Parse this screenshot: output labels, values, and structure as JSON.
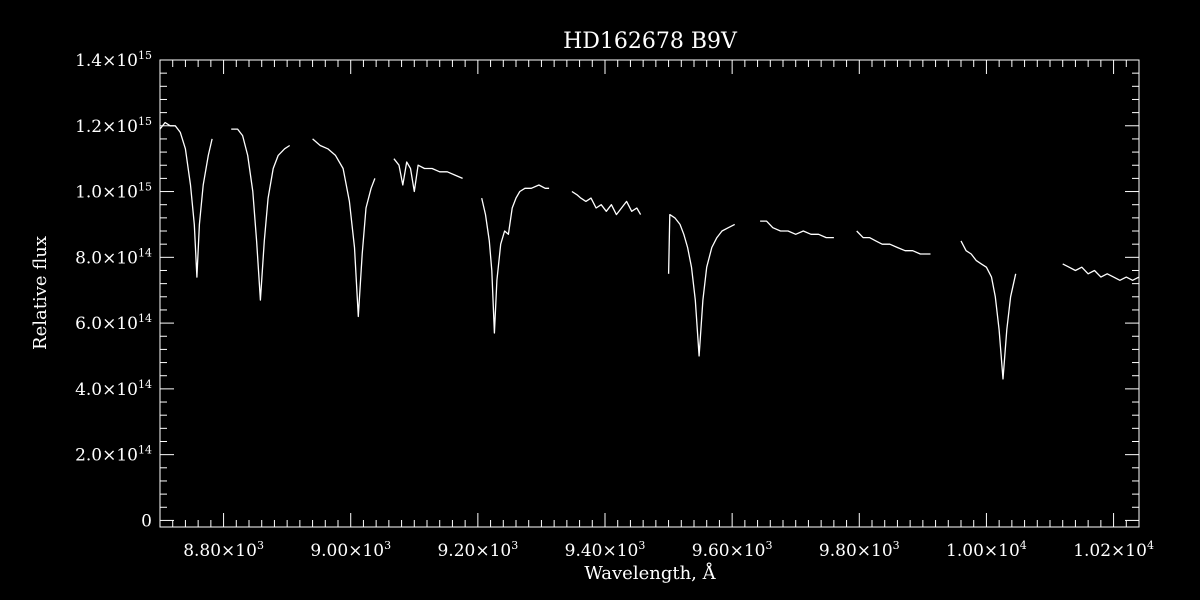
{
  "chart_data": {
    "type": "line",
    "title": "HD162678   B9V",
    "xlabel": "Wavelength, Å",
    "ylabel": "Relative flux",
    "xlim": [
      8700,
      10240
    ],
    "ylim": [
      -0.02,
      1.4
    ],
    "y_unit_exponent": 15,
    "grid": false,
    "line_color": "#ffffff",
    "background": "#000000",
    "x_ticks": [
      {
        "value": 8800,
        "mantissa": "8.80",
        "exp": "3"
      },
      {
        "value": 9000,
        "mantissa": "9.00",
        "exp": "3"
      },
      {
        "value": 9200,
        "mantissa": "9.20",
        "exp": "3"
      },
      {
        "value": 9400,
        "mantissa": "9.40",
        "exp": "3"
      },
      {
        "value": 9600,
        "mantissa": "9.60",
        "exp": "3"
      },
      {
        "value": 9800,
        "mantissa": "9.80",
        "exp": "3"
      },
      {
        "value": 10000,
        "mantissa": "1.00",
        "exp": "4"
      },
      {
        "value": 10200,
        "mantissa": "1.02",
        "exp": "4"
      }
    ],
    "y_ticks": [
      {
        "value": 0.0,
        "mantissa": "0",
        "exp": ""
      },
      {
        "value": 0.2,
        "mantissa": "2.0",
        "exp": "14"
      },
      {
        "value": 0.4,
        "mantissa": "4.0",
        "exp": "14"
      },
      {
        "value": 0.6,
        "mantissa": "6.0",
        "exp": "14"
      },
      {
        "value": 0.8,
        "mantissa": "8.0",
        "exp": "14"
      },
      {
        "value": 1.0,
        "mantissa": "1.0",
        "exp": "15"
      },
      {
        "value": 1.2,
        "mantissa": "1.2",
        "exp": "15"
      },
      {
        "value": 1.4,
        "mantissa": "1.4",
        "exp": "15"
      }
    ],
    "series": [
      {
        "values": [
          [
            8700,
            1.19
          ],
          [
            8708,
            1.21
          ],
          [
            8716,
            1.2
          ],
          [
            8724,
            1.2
          ],
          [
            8732,
            1.18
          ],
          [
            8740,
            1.13
          ],
          [
            8748,
            1.02
          ],
          [
            8754,
            0.9
          ],
          [
            8758,
            0.74
          ],
          [
            8762,
            0.9
          ],
          [
            8768,
            1.02
          ],
          [
            8776,
            1.11
          ],
          [
            8782,
            1.16
          ]
        ]
      },
      {
        "values": [
          [
            8812,
            1.19
          ],
          [
            8822,
            1.19
          ],
          [
            8830,
            1.17
          ],
          [
            8838,
            1.11
          ],
          [
            8846,
            1.0
          ],
          [
            8852,
            0.85
          ],
          [
            8858,
            0.67
          ],
          [
            8864,
            0.85
          ],
          [
            8870,
            0.98
          ],
          [
            8878,
            1.07
          ],
          [
            8886,
            1.11
          ],
          [
            8896,
            1.13
          ],
          [
            8904,
            1.14
          ]
        ]
      },
      {
        "values": [
          [
            8940,
            1.16
          ],
          [
            8952,
            1.14
          ],
          [
            8964,
            1.13
          ],
          [
            8976,
            1.11
          ],
          [
            8988,
            1.07
          ],
          [
            8998,
            0.97
          ],
          [
            9006,
            0.83
          ],
          [
            9012,
            0.62
          ],
          [
            9018,
            0.81
          ],
          [
            9024,
            0.95
          ],
          [
            9032,
            1.01
          ],
          [
            9038,
            1.04
          ]
        ]
      },
      {
        "values": [
          [
            9068,
            1.1
          ],
          [
            9076,
            1.08
          ],
          [
            9082,
            1.02
          ],
          [
            9088,
            1.09
          ],
          [
            9094,
            1.07
          ],
          [
            9100,
            1.0
          ],
          [
            9106,
            1.08
          ],
          [
            9116,
            1.07
          ],
          [
            9128,
            1.07
          ],
          [
            9140,
            1.06
          ],
          [
            9152,
            1.06
          ],
          [
            9164,
            1.05
          ],
          [
            9176,
            1.04
          ]
        ]
      },
      {
        "values": [
          [
            9206,
            0.98
          ],
          [
            9212,
            0.93
          ],
          [
            9218,
            0.85
          ],
          [
            9222,
            0.76
          ],
          [
            9226,
            0.57
          ],
          [
            9230,
            0.73
          ],
          [
            9236,
            0.84
          ],
          [
            9242,
            0.88
          ],
          [
            9248,
            0.87
          ],
          [
            9254,
            0.95
          ],
          [
            9260,
            0.98
          ],
          [
            9266,
            1.0
          ],
          [
            9274,
            1.01
          ],
          [
            9284,
            1.01
          ],
          [
            9296,
            1.02
          ],
          [
            9306,
            1.01
          ],
          [
            9312,
            1.01
          ]
        ]
      },
      {
        "values": [
          [
            9348,
            1.0
          ],
          [
            9356,
            0.99
          ],
          [
            9362,
            0.98
          ],
          [
            9370,
            0.97
          ],
          [
            9378,
            0.98
          ],
          [
            9386,
            0.95
          ],
          [
            9394,
            0.96
          ],
          [
            9402,
            0.94
          ],
          [
            9410,
            0.96
          ],
          [
            9418,
            0.93
          ],
          [
            9426,
            0.95
          ],
          [
            9434,
            0.97
          ],
          [
            9442,
            0.94
          ],
          [
            9450,
            0.95
          ],
          [
            9456,
            0.93
          ]
        ]
      },
      {
        "values": [
          [
            9500,
            0.75
          ],
          [
            9502,
            0.93
          ],
          [
            9510,
            0.92
          ],
          [
            9518,
            0.9
          ],
          [
            9524,
            0.87
          ],
          [
            9530,
            0.83
          ],
          [
            9536,
            0.77
          ],
          [
            9542,
            0.67
          ],
          [
            9548,
            0.5
          ],
          [
            9554,
            0.67
          ],
          [
            9560,
            0.77
          ],
          [
            9568,
            0.83
          ],
          [
            9576,
            0.86
          ],
          [
            9584,
            0.88
          ],
          [
            9594,
            0.89
          ],
          [
            9604,
            0.9
          ]
        ]
      },
      {
        "values": [
          [
            9644,
            0.91
          ],
          [
            9654,
            0.91
          ],
          [
            9664,
            0.89
          ],
          [
            9676,
            0.88
          ],
          [
            9688,
            0.88
          ],
          [
            9700,
            0.87
          ],
          [
            9712,
            0.88
          ],
          [
            9724,
            0.87
          ],
          [
            9736,
            0.87
          ],
          [
            9748,
            0.86
          ],
          [
            9760,
            0.86
          ]
        ]
      },
      {
        "values": [
          [
            9796,
            0.88
          ],
          [
            9806,
            0.86
          ],
          [
            9816,
            0.86
          ],
          [
            9826,
            0.85
          ],
          [
            9836,
            0.84
          ],
          [
            9848,
            0.84
          ],
          [
            9860,
            0.83
          ],
          [
            9872,
            0.82
          ],
          [
            9884,
            0.82
          ],
          [
            9896,
            0.81
          ],
          [
            9906,
            0.81
          ],
          [
            9912,
            0.81
          ]
        ]
      },
      {
        "values": [
          [
            9960,
            0.85
          ],
          [
            9968,
            0.82
          ],
          [
            9976,
            0.81
          ],
          [
            9984,
            0.79
          ],
          [
            9992,
            0.78
          ],
          [
            10000,
            0.77
          ],
          [
            10008,
            0.74
          ],
          [
            10014,
            0.68
          ],
          [
            10020,
            0.58
          ],
          [
            10026,
            0.43
          ],
          [
            10032,
            0.58
          ],
          [
            10038,
            0.68
          ],
          [
            10046,
            0.75
          ]
        ]
      },
      {
        "values": [
          [
            10120,
            0.78
          ],
          [
            10130,
            0.77
          ],
          [
            10140,
            0.76
          ],
          [
            10150,
            0.77
          ],
          [
            10160,
            0.75
          ],
          [
            10170,
            0.76
          ],
          [
            10180,
            0.74
          ],
          [
            10190,
            0.75
          ],
          [
            10200,
            0.74
          ],
          [
            10210,
            0.73
          ],
          [
            10220,
            0.74
          ],
          [
            10230,
            0.73
          ],
          [
            10240,
            0.74
          ]
        ]
      }
    ]
  }
}
